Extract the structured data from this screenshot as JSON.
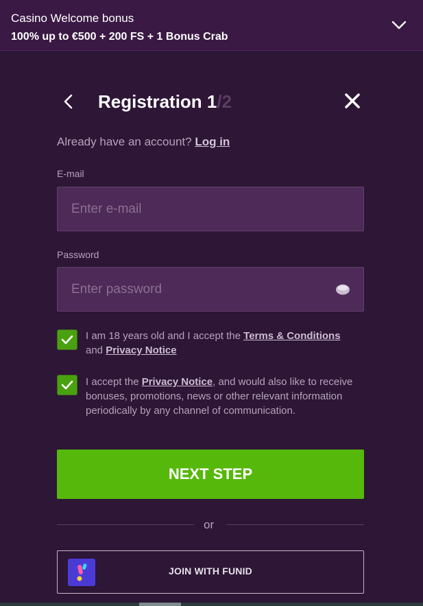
{
  "promo": {
    "title": "Casino Welcome bonus",
    "offer": "100% up to €500 + 200 FS + 1 Bonus Crab"
  },
  "header": {
    "title_prefix": "Registration 1",
    "title_total": "/2"
  },
  "login_prompt": {
    "text": "Already have an account? ",
    "link": "Log in"
  },
  "email": {
    "label": "E-mail",
    "placeholder": "Enter e-mail",
    "value": ""
  },
  "password": {
    "label": "Password",
    "placeholder": "Enter password",
    "value": ""
  },
  "consents": [
    {
      "checked": true,
      "text_1": "I am 18 years old and I accept the ",
      "link_1": "Terms & Conditions",
      "text_2": " and ",
      "link_2": "Privacy Notice"
    },
    {
      "checked": true,
      "text_1": "I accept the ",
      "link_1": "Privacy Notice",
      "text_2": ", and would also like to receive bonuses, promotions, news or other relevant information periodically by any channel of communication."
    }
  ],
  "next_button": "NEXT STEP",
  "divider": "or",
  "funid_button": "JOIN WITH FUNID",
  "colors": {
    "background": "#2d1636",
    "promo_bar": "#3a1944",
    "input_bg": "#4d2a58",
    "accent_green": "#56b80a",
    "checkbox_green": "#4aa10f",
    "funid_logo": "#4b3bd6"
  },
  "icons": [
    "chevron-down-icon",
    "back-arrow-icon",
    "close-icon",
    "eye-icon",
    "checkmark-icon",
    "funid-logo-icon"
  ]
}
